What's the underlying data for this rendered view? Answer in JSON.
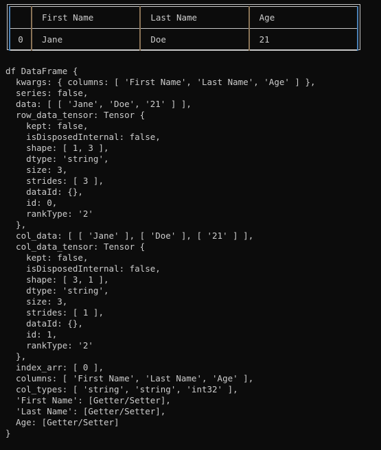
{
  "table": {
    "columns": [
      "",
      "First Name",
      "Last Name",
      "Age"
    ],
    "rows": [
      [
        "0",
        "Jane",
        "Doe",
        "21"
      ]
    ]
  },
  "console": {
    "lines": [
      "df DataFrame {",
      "  kwargs: { columns: [ 'First Name', 'Last Name', 'Age' ] },",
      "  series: false,",
      "  data: [ [ 'Jane', 'Doe', '21' ] ],",
      "  row_data_tensor: Tensor {",
      "    kept: false,",
      "    isDisposedInternal: false,",
      "    shape: [ 1, 3 ],",
      "    dtype: 'string',",
      "    size: 3,",
      "    strides: [ 3 ],",
      "    dataId: {},",
      "    id: 0,",
      "    rankType: '2'",
      "  },",
      "  col_data: [ [ 'Jane' ], [ 'Doe' ], [ '21' ] ],",
      "  col_data_tensor: Tensor {",
      "    kept: false,",
      "    isDisposedInternal: false,",
      "    shape: [ 3, 1 ],",
      "    dtype: 'string',",
      "    size: 3,",
      "    strides: [ 1 ],",
      "    dataId: {},",
      "    id: 1,",
      "    rankType: '2'",
      "  },",
      "  index_arr: [ 0 ],",
      "  columns: [ 'First Name', 'Last Name', 'Age' ],",
      "  col_types: [ 'string', 'string', 'int32' ],",
      "  'First Name': [Getter/Setter],",
      "  'Last Name': [Getter/Setter],",
      "  Age: [Getter/Setter]",
      "}"
    ]
  }
}
